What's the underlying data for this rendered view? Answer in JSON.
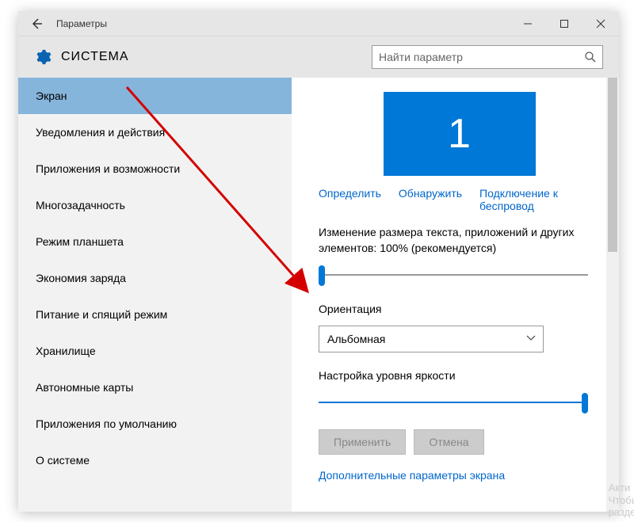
{
  "window": {
    "title": "Параметры"
  },
  "header": {
    "section": "СИСТЕМА",
    "search_placeholder": "Найти параметр"
  },
  "sidebar": {
    "items": [
      "Экран",
      "Уведомления и действия",
      "Приложения и возможности",
      "Многозадачность",
      "Режим планшета",
      "Экономия заряда",
      "Питание и спящий режим",
      "Хранилище",
      "Автономные карты",
      "Приложения по умолчанию",
      "О системе"
    ],
    "selected_index": 0
  },
  "display": {
    "monitor_id": "1",
    "links": {
      "identify": "Определить",
      "detect": "Обнаружить",
      "wireless": "Подключение к беспровод"
    },
    "scale_label": "Изменение размера текста, приложений и других элементов: 100% (рекомендуется)",
    "scale_percent": 0,
    "orientation_label": "Ориентация",
    "orientation_value": "Альбомная",
    "brightness_label": "Настройка уровня яркости",
    "brightness_percent": 100,
    "apply_btn": "Применить",
    "cancel_btn": "Отмена",
    "advanced_link": "Дополнительные параметры экрана"
  },
  "activation": {
    "line1": "Акти",
    "line2": "Чтобь",
    "line3": "разде."
  }
}
